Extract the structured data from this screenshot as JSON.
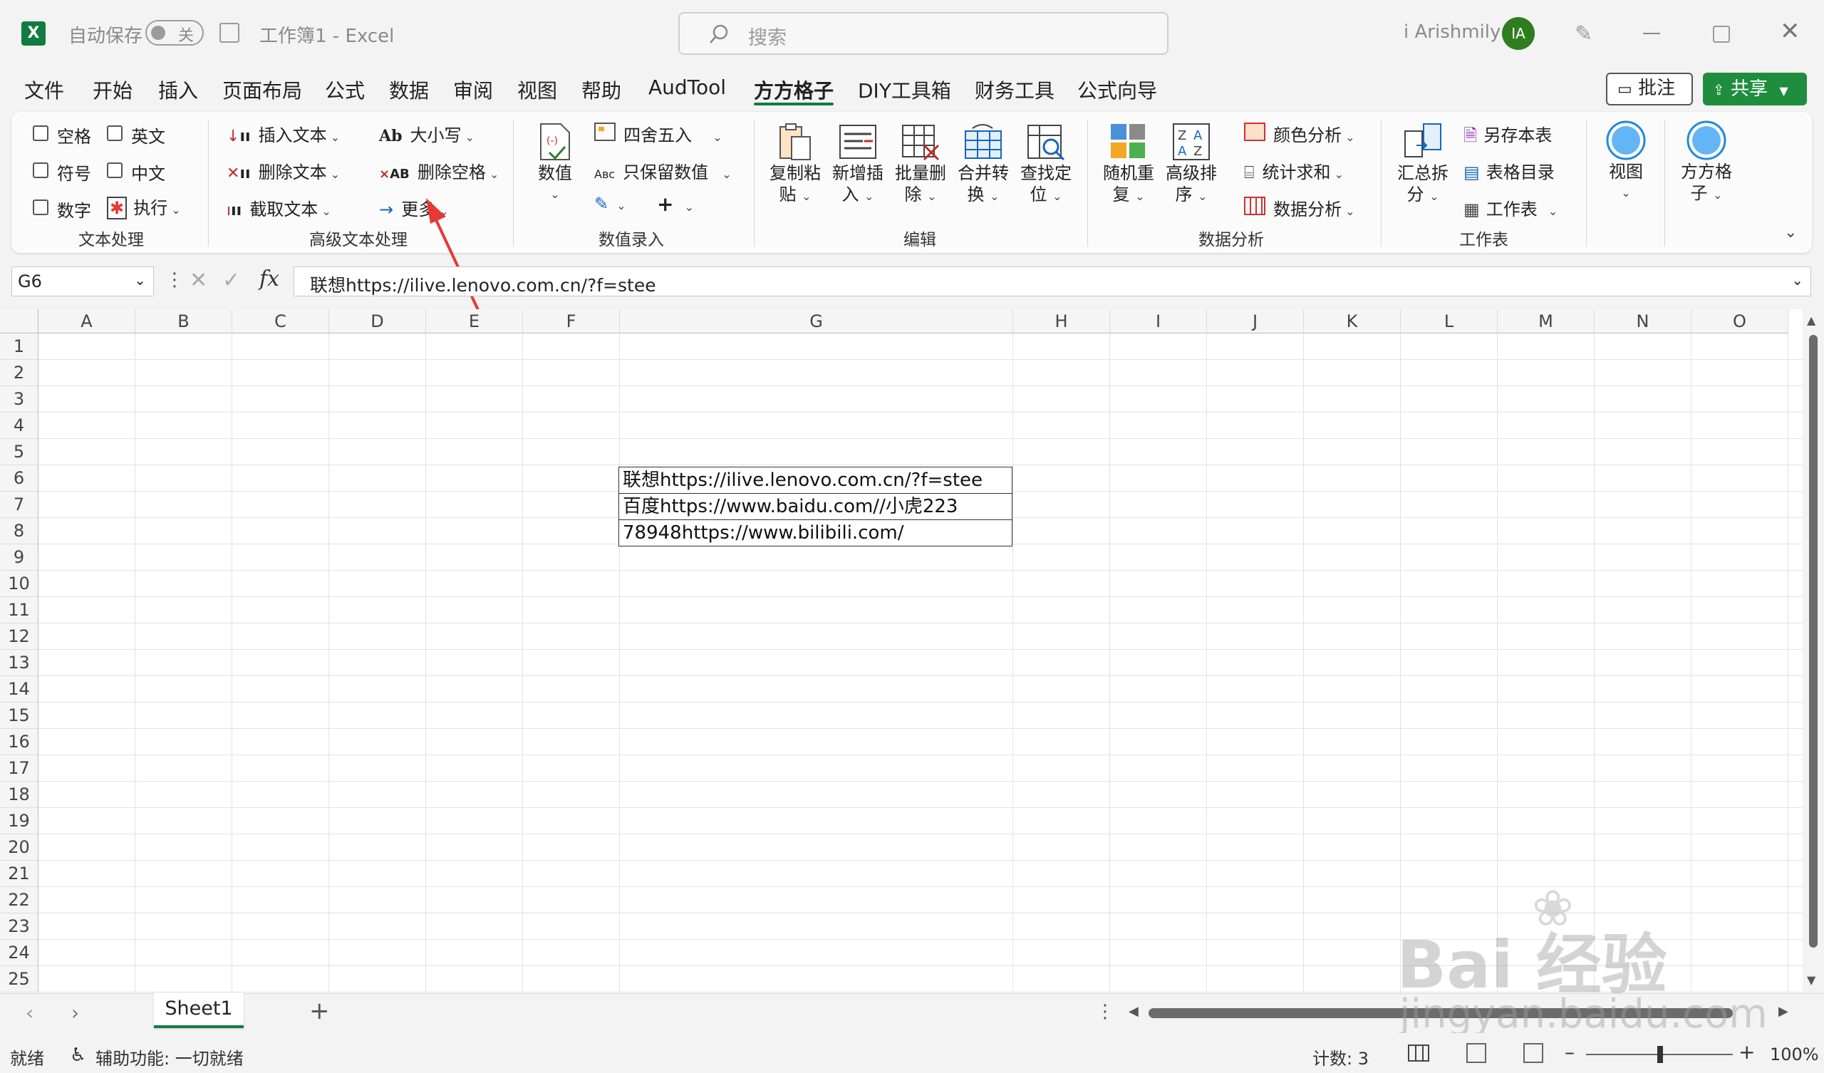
{
  "titlebar": {
    "autosave_label": "自动保存",
    "autosave_state": "关",
    "doc_title": "工作簿1 - Excel",
    "search_placeholder": "搜索",
    "user_name": "i Arishmily",
    "avatar_initials": "IA"
  },
  "menu": [
    "文件",
    "开始",
    "插入",
    "页面布局",
    "公式",
    "数据",
    "审阅",
    "视图",
    "帮助",
    "AudTool",
    "方方格子",
    "DIY工具箱",
    "财务工具",
    "公式向导"
  ],
  "menu_active": "方方格子",
  "actions": {
    "comment": "批注",
    "share": "共享"
  },
  "ribbon": {
    "text_processing": {
      "checkboxes": [
        "空格",
        "英文",
        "符号",
        "中文",
        "数字"
      ],
      "execute": "执行",
      "label": "文本处理"
    },
    "advanced_text": {
      "insert_text": "插入文本",
      "delete_text": "删除文本",
      "extract_text": "截取文本",
      "case": "大小写",
      "delete_space": "删除空格",
      "more": "更多",
      "label": "高级文本处理"
    },
    "data_entry": {
      "value": "数值",
      "round": "四舍五入",
      "keep_numbers": "只保留数值",
      "label": "数值录入"
    },
    "edit": {
      "copy_paste": [
        "复制粘",
        "贴"
      ],
      "new_insert": [
        "新增插",
        "入"
      ],
      "batch_delete": [
        "批量删",
        "除"
      ],
      "merge_convert": [
        "合并转",
        "换"
      ],
      "find_locate": [
        "查找定",
        "位"
      ],
      "label": "编辑"
    },
    "data_analysis": {
      "random_repeat": [
        "随机重",
        "复"
      ],
      "advanced_sort": [
        "高级排",
        "序"
      ],
      "color_analysis": "颜色分析",
      "stat_sum": "统计求和",
      "data_analysis": "数据分析",
      "label": "数据分析"
    },
    "worksheet": {
      "summary_split": [
        "汇总拆",
        "分"
      ],
      "save_sheet": "另存本表",
      "sheet_index": "表格目录",
      "worksheet": "工作表",
      "label": "工作表"
    },
    "view": "视图",
    "ffgz": [
      "方方格",
      "子"
    ]
  },
  "formula_bar": {
    "name_box": "G6",
    "fx": "fx",
    "content": "联想https://ilive.lenovo.com.cn/?f=stee"
  },
  "grid": {
    "columns": [
      "A",
      "B",
      "C",
      "D",
      "E",
      "F",
      "G",
      "H",
      "I",
      "J",
      "K",
      "L",
      "M",
      "N",
      "O"
    ],
    "rows": [
      "1",
      "2",
      "3",
      "4",
      "5",
      "6",
      "7",
      "8",
      "9",
      "10",
      "11",
      "12",
      "13",
      "14",
      "15",
      "16",
      "17",
      "18",
      "19",
      "20",
      "21",
      "22",
      "23",
      "24",
      "25"
    ],
    "cells": [
      "联想https://ilive.lenovo.com.cn/?f=stee",
      "百度https://www.baidu.com//小虎223",
      "78948https://www.bilibili.com/"
    ]
  },
  "sheet_tabs": {
    "active": "Sheet1",
    "add": "+"
  },
  "status": {
    "ready": "就绪",
    "accessibility": "辅助功能: 一切就绪",
    "count": "计数: 3",
    "zoom": "100%"
  },
  "watermark": {
    "logo": "Bai 经验",
    "url": "jingyan.baidu.com"
  },
  "colors": {
    "excel_green": "#107c41",
    "share_green": "#1e8e3e",
    "arrow_red": "#e53935",
    "ribbon_bg": "#fbfbfb"
  }
}
